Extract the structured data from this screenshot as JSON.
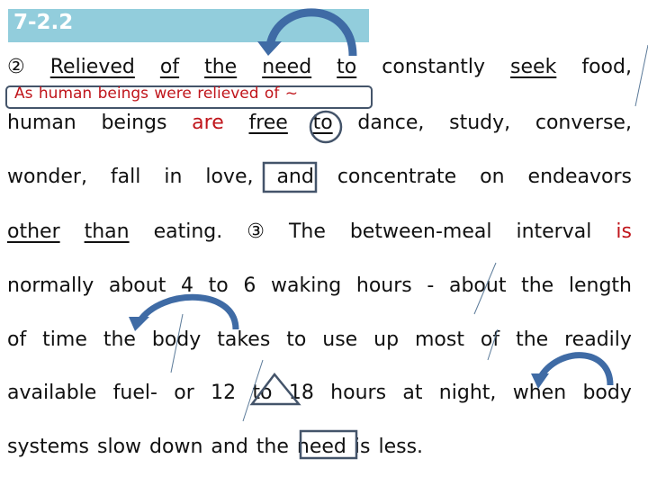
{
  "header": {
    "title": "7-2.2",
    "background": "#92CDDC"
  },
  "hint": {
    "text": "As human beings were relieved of ~",
    "color": "#C0151B"
  },
  "lines": [
    {
      "words": [
        {
          "t": "②"
        },
        {
          "t": "Relieved",
          "u": true
        },
        {
          "t": "of",
          "u": true
        },
        {
          "t": "the",
          "u": true
        },
        {
          "t": "need",
          "u": true
        },
        {
          "t": "to",
          "u": true
        },
        {
          "t": "constantly"
        },
        {
          "t": "seek",
          "u": true
        },
        {
          "t": "food,"
        }
      ]
    },
    {
      "words": [
        {
          "t": "human"
        },
        {
          "t": "beings"
        },
        {
          "t": "are",
          "red": true
        },
        {
          "t": "free",
          "u": true
        },
        {
          "t": "to",
          "u": true
        },
        {
          "t": "dance,"
        },
        {
          "t": "study,"
        },
        {
          "t": "converse,"
        }
      ]
    },
    {
      "words": [
        {
          "t": "wonder,"
        },
        {
          "t": "fall"
        },
        {
          "t": "in"
        },
        {
          "t": "love,"
        },
        {
          "t": "and"
        },
        {
          "t": "concentrate"
        },
        {
          "t": "on"
        },
        {
          "t": "endeavors"
        }
      ]
    },
    {
      "words": [
        {
          "t": "other",
          "u": true
        },
        {
          "t": "than",
          "u": true
        },
        {
          "t": "eating."
        },
        {
          "t": "③"
        },
        {
          "t": "The"
        },
        {
          "t": "between-meal"
        },
        {
          "t": "interval"
        },
        {
          "t": "is",
          "red": true
        }
      ]
    },
    {
      "words": [
        {
          "t": "normally"
        },
        {
          "t": "about"
        },
        {
          "t": "4"
        },
        {
          "t": "to"
        },
        {
          "t": "6"
        },
        {
          "t": "waking"
        },
        {
          "t": "hours"
        },
        {
          "t": "-"
        },
        {
          "t": "about"
        },
        {
          "t": "the"
        },
        {
          "t": "length"
        }
      ]
    },
    {
      "words": [
        {
          "t": "of"
        },
        {
          "t": "time"
        },
        {
          "t": "the"
        },
        {
          "t": "body"
        },
        {
          "t": "takes"
        },
        {
          "t": "to"
        },
        {
          "t": "use"
        },
        {
          "t": "up"
        },
        {
          "t": "most"
        },
        {
          "t": "of"
        },
        {
          "t": "the"
        },
        {
          "t": "readily"
        }
      ]
    },
    {
      "words": [
        {
          "t": "available"
        },
        {
          "t": "fuel-"
        },
        {
          "t": "or"
        },
        {
          "t": "12"
        },
        {
          "t": "to"
        },
        {
          "t": "18"
        },
        {
          "t": "hours"
        },
        {
          "t": "at"
        },
        {
          "t": "night,"
        },
        {
          "t": "when"
        },
        {
          "t": "body"
        }
      ]
    },
    {
      "words": [
        {
          "t": "systems"
        },
        {
          "t": "slow"
        },
        {
          "t": "down"
        },
        {
          "t": "and"
        },
        {
          "t": "the"
        },
        {
          "t": "need"
        },
        {
          "t": "is"
        },
        {
          "t": "less."
        }
      ],
      "align": "left"
    }
  ],
  "annotations": {
    "stroke_color": "#44546A",
    "arrow_color": "#3F6BA5",
    "slash_color": "#5B7A99"
  }
}
